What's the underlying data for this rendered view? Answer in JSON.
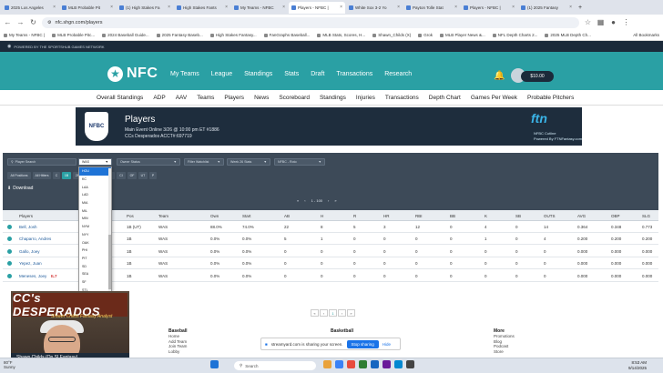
{
  "browser": {
    "tabs": [
      {
        "label": "2025 Los Angeles",
        "active": false
      },
      {
        "label": "MLB Probable Pit",
        "active": false
      },
      {
        "label": "(1) High Stakes Fa",
        "active": false
      },
      {
        "label": "High Stakes Fants",
        "active": false
      },
      {
        "label": "My Teams - NFBC",
        "active": false
      },
      {
        "label": "Players - NFBC |",
        "active": true
      },
      {
        "label": "White Sox 3-2 Yo",
        "active": false
      },
      {
        "label": "Payton Tolle Stat",
        "active": false
      },
      {
        "label": "Players - NFBC |",
        "active": false
      },
      {
        "label": "(1) 2025 Fantasy",
        "active": false
      }
    ],
    "url": "nfc.shgn.com/players",
    "bookmarks": [
      "My Teams - NFBC |",
      "MLB Probable Pitc...",
      "2024 Baseball Guide...",
      "2025 Fantasy Baseb...",
      "High Stakes Fantasy...",
      "FanGraphs Baseball...",
      "MLB Stats, Scores, H...",
      "Shawn_Childs (X)",
      "Grok",
      "MLB Player News &...",
      "NFL Depth Charts 2...",
      "2025 MLB Depth Ch..."
    ],
    "all_bookmarks": "All Bookmarks"
  },
  "site": {
    "powered_by": "POWERED BY THE SPORTSHUB GAMES NETWORK",
    "logo_text": "NFC",
    "nav": [
      "My Teams",
      "League",
      "Standings",
      "Stats",
      "Draft",
      "Transactions",
      "Research"
    ],
    "balance": "$10.00",
    "subnav": [
      "Overall Standings",
      "ADP",
      "AAV",
      "Teams",
      "Players",
      "News",
      "Scoreboard",
      "Standings",
      "Injuries",
      "Transactions",
      "Depth Chart",
      "Games Per Week",
      "Probable Pitchers"
    ]
  },
  "banner": {
    "shield_text": "NFBC",
    "title": "Players",
    "line1": "Main Event Online 3/26 @ 10:00 pm ET #1886",
    "line2": "CCs Desperados ACCT#:697719",
    "ftn_logo": "ftn",
    "ftn_line1": "NFBC Cutline",
    "ftn_line2": "Powered By FTNFantasy.com"
  },
  "filters": {
    "search_placeholder": "Player Search",
    "team_select": "WAS",
    "owner_status": "Owner Status",
    "watchlist": "Filter Watchlist",
    "stat_period": "Week 26 Stats",
    "roto": "NFBC - Roto",
    "position_pills": [
      "All Positions",
      "All Hitters",
      "C",
      "1B",
      "2B",
      "3B",
      "SS",
      "MI",
      "CI",
      "OF",
      "UT",
      "P"
    ],
    "download": "Download",
    "pager": "1 - 100"
  },
  "team_dropdown": [
    "HOU",
    "KC",
    "LAA",
    "LAD",
    "MIA",
    "MIL",
    "MIN",
    "NYM",
    "NYY",
    "OAK",
    "PHI",
    "PIT",
    "SD",
    "SEA",
    "SF",
    "STL",
    "TB"
  ],
  "table": {
    "headers": [
      "Players",
      "Pos",
      "Team",
      "Own",
      "Start",
      "AB",
      "H",
      "R",
      "HR",
      "RBI",
      "BB",
      "K",
      "SB",
      "OUTS",
      "AVG",
      "OBP",
      "SLG"
    ],
    "rows": [
      {
        "player": "Bell, Josh",
        "pos": "1B (UT)",
        "team": "WAS",
        "own": "88.0%",
        "start": "74.0%",
        "ab": "22",
        "h": "8",
        "r": "5",
        "hr": "3",
        "rbi": "12",
        "bb": "0",
        "k": "4",
        "sb": "0",
        "outs": "14",
        "avg": "0.364",
        "obp": "0.348",
        "slg": "0.773"
      },
      {
        "player": "Chaparro, Andres",
        "pos": "1B",
        "team": "WAS",
        "own": "0.0%",
        "start": "0.0%",
        "ab": "5",
        "h": "1",
        "r": "0",
        "hr": "0",
        "rbi": "0",
        "bb": "0",
        "k": "1",
        "sb": "0",
        "outs": "4",
        "avg": "0.200",
        "obp": "0.200",
        "slg": "0.200"
      },
      {
        "player": "Gallo, Joey",
        "pos": "1B",
        "team": "WAS",
        "own": "0.0%",
        "start": "0.0%",
        "ab": "0",
        "h": "0",
        "r": "0",
        "hr": "0",
        "rbi": "0",
        "bb": "0",
        "k": "0",
        "sb": "0",
        "outs": "0",
        "avg": "0.000",
        "obp": "0.000",
        "slg": "0.000"
      },
      {
        "player": "Yepez, Juan",
        "pos": "1B",
        "team": "WAS",
        "own": "0.0%",
        "start": "0.0%",
        "ab": "0",
        "h": "0",
        "r": "0",
        "hr": "0",
        "rbi": "0",
        "bb": "0",
        "k": "0",
        "sb": "0",
        "outs": "0",
        "avg": "0.000",
        "obp": "0.000",
        "slg": "0.000"
      },
      {
        "player": "Meneses, Joey",
        "pos": "1B",
        "team": "WAS",
        "own": "0.0%",
        "start": "0.0%",
        "ab": "0",
        "h": "0",
        "r": "0",
        "hr": "0",
        "rbi": "0",
        "bb": "0",
        "k": "0",
        "sb": "0",
        "outs": "0",
        "avg": "0.000",
        "obp": "0.000",
        "slg": "0.000"
      }
    ],
    "note": "--Some players may be hid... elected filters--",
    "injury_tag": "IL7"
  },
  "footer": {
    "col1_title": "Baseball",
    "col1": [
      "Home",
      "Add Team",
      "Join Team",
      "Lobby"
    ],
    "col2_title": "Basketball",
    "col3_title": "More",
    "col3": [
      "Promotions",
      "Blog",
      "Podcast",
      "Store"
    ]
  },
  "webcam": {
    "title": "CC's DESPERADOS",
    "subtitle": "Shawn Childs Fantasy Analyst",
    "name": "Shawn Childs (On SI Fantasy)"
  },
  "share_bar": {
    "message": "streamyard.com is sharing your screen.",
    "stop": "Stop sharing",
    "hide": "Hide"
  },
  "taskbar": {
    "weather_temp": "80°F",
    "weather_desc": "Sunny",
    "search": "Search",
    "time": "8:53 AM",
    "date": "9/14/2025"
  },
  "colors": {
    "nav_teal": "#2aa0a4",
    "dark_navy": "#1e2d3d",
    "filter_panel": "#3d4a58",
    "selected_blue": "#1e73d6",
    "share_blue": "#1a73e8"
  }
}
